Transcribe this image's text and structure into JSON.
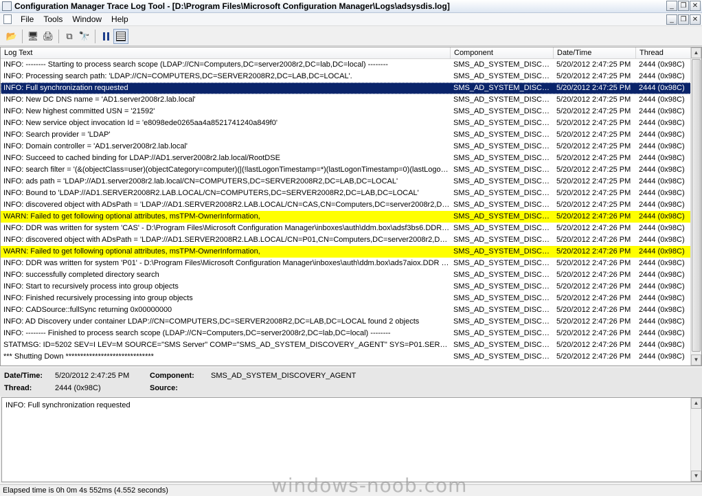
{
  "window": {
    "title": "Configuration Manager Trace Log Tool - [D:\\Program Files\\Microsoft Configuration Manager\\Logs\\adsysdis.log]"
  },
  "menu": [
    "File",
    "Tools",
    "Window",
    "Help"
  ],
  "toolbar": {
    "buttons": [
      "open-icon",
      "print-preview-icon",
      "print-icon",
      "copy-icon",
      "find-icon",
      "pause-icon",
      "highlight-icon"
    ]
  },
  "grid": {
    "columns": [
      "Log Text",
      "Component",
      "Date/Time",
      "Thread"
    ],
    "rows": [
      {
        "text": "INFO: -------- Starting to process search scope (LDAP://CN=Computers,DC=server2008r2,DC=lab,DC=local) --------",
        "component": "SMS_AD_SYSTEM_DISCOVE",
        "datetime": "5/20/2012 2:47:25 PM",
        "thread": "2444 (0x98C)"
      },
      {
        "text": "INFO: Processing search path: 'LDAP://CN=COMPUTERS,DC=SERVER2008R2,DC=LAB,DC=LOCAL'.",
        "component": "SMS_AD_SYSTEM_DISCOVE",
        "datetime": "5/20/2012 2:47:25 PM",
        "thread": "2444 (0x98C)"
      },
      {
        "text": "INFO: Full synchronization requested",
        "component": "SMS_AD_SYSTEM_DISCOVE",
        "datetime": "5/20/2012 2:47:25 PM",
        "thread": "2444 (0x98C)",
        "selected": true
      },
      {
        "text": "INFO: New DC DNS name = 'AD1.server2008r2.lab.local'",
        "component": "SMS_AD_SYSTEM_DISCOVE",
        "datetime": "5/20/2012 2:47:25 PM",
        "thread": "2444 (0x98C)"
      },
      {
        "text": "INFO: New highest committed USN = '21592'",
        "component": "SMS_AD_SYSTEM_DISCOVE",
        "datetime": "5/20/2012 2:47:25 PM",
        "thread": "2444 (0x98C)"
      },
      {
        "text": "INFO: New service object invocation Id = 'e8098ede0265aa4a8521741240a849f0'",
        "component": "SMS_AD_SYSTEM_DISCOVE",
        "datetime": "5/20/2012 2:47:25 PM",
        "thread": "2444 (0x98C)"
      },
      {
        "text": "INFO: Search provider = 'LDAP'",
        "component": "SMS_AD_SYSTEM_DISCOVE",
        "datetime": "5/20/2012 2:47:25 PM",
        "thread": "2444 (0x98C)"
      },
      {
        "text": "INFO: Domain controller = 'AD1.server2008r2.lab.local'",
        "component": "SMS_AD_SYSTEM_DISCOVE",
        "datetime": "5/20/2012 2:47:25 PM",
        "thread": "2444 (0x98C)"
      },
      {
        "text": "INFO: Succeed to cached binding for LDAP://AD1.server2008r2.lab.local/RootDSE",
        "component": "SMS_AD_SYSTEM_DISCOVE",
        "datetime": "5/20/2012 2:47:25 PM",
        "thread": "2444 (0x98C)"
      },
      {
        "text": "INFO: search filter = '(&(objectClass=user)(objectCategory=computer)(|(!lastLogonTimestamp=*)(lastLogonTimestamp=0)(lastLogonTimest...",
        "component": "SMS_AD_SYSTEM_DISCOVE",
        "datetime": "5/20/2012 2:47:25 PM",
        "thread": "2444 (0x98C)"
      },
      {
        "text": "INFO: ads path = 'LDAP://AD1.server2008r2.lab.local/CN=COMPUTERS,DC=SERVER2008R2,DC=LAB,DC=LOCAL'",
        "component": "SMS_AD_SYSTEM_DISCOVE",
        "datetime": "5/20/2012 2:47:25 PM",
        "thread": "2444 (0x98C)"
      },
      {
        "text": "INFO: Bound to 'LDAP://AD1.SERVER2008R2.LAB.LOCAL/CN=COMPUTERS,DC=SERVER2008R2,DC=LAB,DC=LOCAL'",
        "component": "SMS_AD_SYSTEM_DISCOVE",
        "datetime": "5/20/2012 2:47:25 PM",
        "thread": "2444 (0x98C)"
      },
      {
        "text": "INFO: discovered object with ADsPath = 'LDAP://AD1.SERVER2008R2.LAB.LOCAL/CN=CAS,CN=Computers,DC=server2008r2,DC=l...",
        "component": "SMS_AD_SYSTEM_DISCOVE",
        "datetime": "5/20/2012 2:47:25 PM",
        "thread": "2444 (0x98C)"
      },
      {
        "text": "WARN:  Failed to get following optional attributes, msTPM-OwnerInformation,",
        "component": "SMS_AD_SYSTEM_DISCOVE",
        "datetime": "5/20/2012 2:47:26 PM",
        "thread": "2444 (0x98C)",
        "warn": true
      },
      {
        "text": "INFO: DDR was written for system 'CAS' - D:\\Program Files\\Microsoft Configuration Manager\\inboxes\\auth\\ddm.box\\adsf3bs6.DDR at ...",
        "component": "SMS_AD_SYSTEM_DISCOVE",
        "datetime": "5/20/2012 2:47:26 PM",
        "thread": "2444 (0x98C)"
      },
      {
        "text": "INFO: discovered object with ADsPath = 'LDAP://AD1.SERVER2008R2.LAB.LOCAL/CN=P01,CN=Computers,DC=server2008r2,DC=l...",
        "component": "SMS_AD_SYSTEM_DISCOVE",
        "datetime": "5/20/2012 2:47:26 PM",
        "thread": "2444 (0x98C)"
      },
      {
        "text": "WARN:  Failed to get following optional attributes, msTPM-OwnerInformation,",
        "component": "SMS_AD_SYSTEM_DISCOVE",
        "datetime": "5/20/2012 2:47:26 PM",
        "thread": "2444 (0x98C)",
        "warn": true
      },
      {
        "text": "INFO: DDR was written for system 'P01' - D:\\Program Files\\Microsoft Configuration Manager\\inboxes\\auth\\ddm.box\\ads7aiox.DDR at ...",
        "component": "SMS_AD_SYSTEM_DISCOVE",
        "datetime": "5/20/2012 2:47:26 PM",
        "thread": "2444 (0x98C)"
      },
      {
        "text": "INFO: successfully completed directory search",
        "component": "SMS_AD_SYSTEM_DISCOVE",
        "datetime": "5/20/2012 2:47:26 PM",
        "thread": "2444 (0x98C)"
      },
      {
        "text": "INFO: Start to recursively process into group objects",
        "component": "SMS_AD_SYSTEM_DISCOVE",
        "datetime": "5/20/2012 2:47:26 PM",
        "thread": "2444 (0x98C)"
      },
      {
        "text": "INFO: Finished recursively processing into group objects",
        "component": "SMS_AD_SYSTEM_DISCOVE",
        "datetime": "5/20/2012 2:47:26 PM",
        "thread": "2444 (0x98C)"
      },
      {
        "text": "INFO: CADSource::fullSync returning 0x00000000",
        "component": "SMS_AD_SYSTEM_DISCOVE",
        "datetime": "5/20/2012 2:47:26 PM",
        "thread": "2444 (0x98C)"
      },
      {
        "text": "INFO: AD Discovery under container LDAP://CN=COMPUTERS,DC=SERVER2008R2,DC=LAB,DC=LOCAL found 2 objects",
        "component": "SMS_AD_SYSTEM_DISCOVE",
        "datetime": "5/20/2012 2:47:26 PM",
        "thread": "2444 (0x98C)"
      },
      {
        "text": "INFO: -------- Finished to process search scope (LDAP://CN=Computers,DC=server2008r2,DC=lab,DC=local) --------",
        "component": "SMS_AD_SYSTEM_DISCOVE",
        "datetime": "5/20/2012 2:47:26 PM",
        "thread": "2444 (0x98C)"
      },
      {
        "text": "STATMSG: ID=5202 SEV=I LEV=M SOURCE=\"SMS Server\" COMP=\"SMS_AD_SYSTEM_DISCOVERY_AGENT\" SYS=P01.SERVE...",
        "component": "SMS_AD_SYSTEM_DISCOVE",
        "datetime": "5/20/2012 2:47:26 PM",
        "thread": "2444 (0x98C)"
      },
      {
        "text": "*** Shutting Down ******************************",
        "component": "SMS_AD_SYSTEM_DISCOVE",
        "datetime": "5/20/2012 2:47:26 PM",
        "thread": "2444 (0x98C)"
      }
    ]
  },
  "details": {
    "datetime_label": "Date/Time:",
    "datetime_value": "5/20/2012 2:47:25 PM",
    "component_label": "Component:",
    "component_value": "SMS_AD_SYSTEM_DISCOVERY_AGENT",
    "thread_label": "Thread:",
    "thread_value": "2444 (0x98C)",
    "source_label": "Source:",
    "source_value": ""
  },
  "message": "INFO: Full synchronization requested",
  "status": "Elapsed time is 0h 0m 4s 552ms (4.552 seconds)",
  "watermark": "windows-noob.com",
  "colors": {
    "selected": "#0a246a",
    "warn": "#ffff00"
  }
}
